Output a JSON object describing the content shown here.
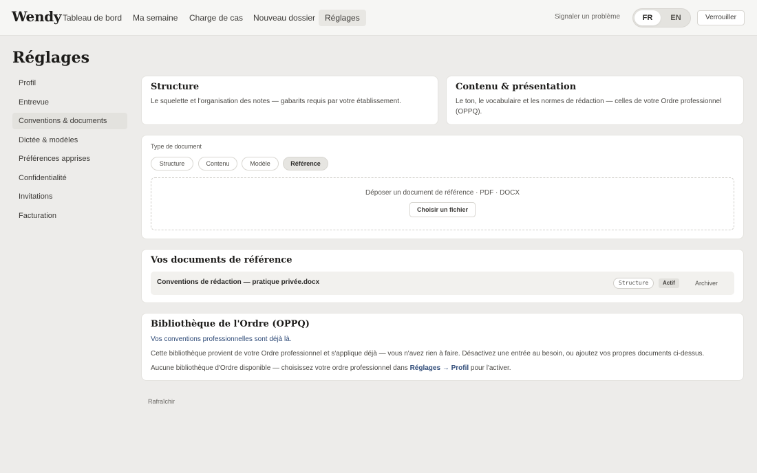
{
  "app": {
    "logo": "Wendy"
  },
  "nav": {
    "items": [
      "Tableau de bord",
      "Ma semaine",
      "Charge de cas",
      "Nouveau dossier",
      "Réglages"
    ],
    "active": "Réglages",
    "report": "Signaler un problème",
    "lang_fr": "FR",
    "lang_en": "EN",
    "lock": "Verrouiller"
  },
  "page": {
    "title": "Réglages"
  },
  "sidebar": {
    "items": [
      {
        "label": "Profil"
      },
      {
        "label": "Entrevue"
      },
      {
        "label": "Conventions & documents",
        "active": true
      },
      {
        "label": "Dictée & modèles"
      },
      {
        "label": "Préférences apprises"
      },
      {
        "label": "Confidentialité"
      },
      {
        "label": "Invitations"
      },
      {
        "label": "Facturation"
      }
    ]
  },
  "structure_card": {
    "title": "Structure",
    "text": "Le squelette et l'organisation des notes — gabarits requis par votre établissement."
  },
  "content_card": {
    "title": "Contenu & présentation",
    "text": "Le ton, le vocabulaire et les normes de rédaction — celles de votre Ordre professionnel (OPPQ)."
  },
  "upload": {
    "type_label": "Type de document",
    "types": [
      "Structure",
      "Contenu",
      "Modèle",
      "Référence"
    ],
    "active_type": "Référence",
    "drop_text": "Déposer un document de référence · PDF · DOCX",
    "choose_file": "Choisir un fichier"
  },
  "docs": {
    "title": "Vos documents de référence",
    "rows": [
      {
        "name": "Conventions de rédaction — pratique privée.docx",
        "type": "Structure",
        "status": "Actif",
        "action": "Archiver"
      }
    ]
  },
  "library": {
    "title": "Bibliothèque de l'Ordre (OPPQ)",
    "line1": "Vos conventions professionnelles sont déjà là.",
    "line2": "Cette bibliothèque provient de votre Ordre professionnel et s'applique déjà — vous n'avez rien à faire. Désactivez une entrée au besoin, ou ajoutez vos propres documents ci-dessus.",
    "line3_pre": "Aucune bibliothèque d'Ordre disponible — choisissez votre ordre professionnel dans ",
    "line3_link": "Réglages → Profil",
    "line3_post": " pour l'activer."
  },
  "footer": {
    "refresh": "Rafraîchir"
  }
}
